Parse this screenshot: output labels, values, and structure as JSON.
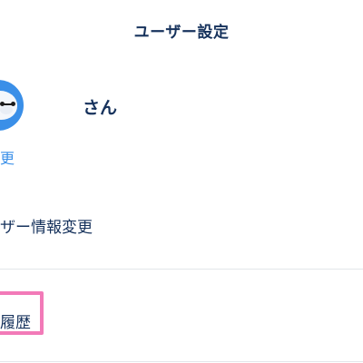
{
  "header": {
    "title": "ユーザー設定"
  },
  "profile": {
    "name": "さん",
    "change_link": "更"
  },
  "menu": {
    "user_info_label": "ザー情報変更",
    "history_label": "履歴"
  },
  "colors": {
    "text": "#16325c",
    "link": "#3a8fe8",
    "highlight": "#f27ab8",
    "divider": "#e3e6ea",
    "avatar_bg": "#3a8fe8"
  },
  "icons": {
    "avatar": "robot-avatar-icon"
  }
}
